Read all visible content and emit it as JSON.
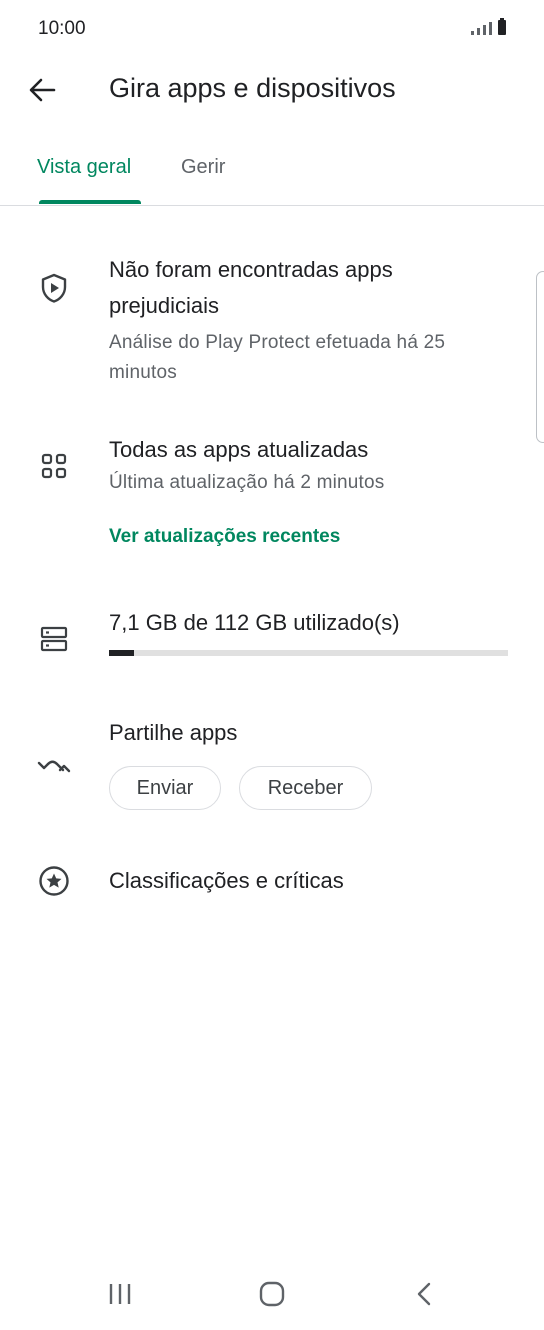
{
  "status_bar": {
    "time": "10:00"
  },
  "header": {
    "title": "Gira apps e dispositivos"
  },
  "tabs": [
    {
      "label": "Vista geral"
    },
    {
      "label": "Gerir"
    }
  ],
  "protect": {
    "title_line1": "Não foram encontradas apps",
    "title_line2": "prejudiciais",
    "subtitle_line1": "Análise do Play Protect efetuada há 25",
    "subtitle_line2": "minutos"
  },
  "updates": {
    "title": "Todas as apps atualizadas",
    "subtitle": "Última atualização há 2 minutos",
    "link": "Ver atualizações recentes"
  },
  "storage": {
    "label": "7,1 GB de 112 GB utilizado(s)",
    "used_fraction": 0.063
  },
  "share": {
    "title": "Partilhe apps",
    "send_label": "Enviar",
    "receive_label": "Receber"
  },
  "ratings": {
    "label": "Classificações e críticas"
  },
  "colors": {
    "accent": "#01875f",
    "text": "#202124",
    "secondary": "#5f6368"
  }
}
